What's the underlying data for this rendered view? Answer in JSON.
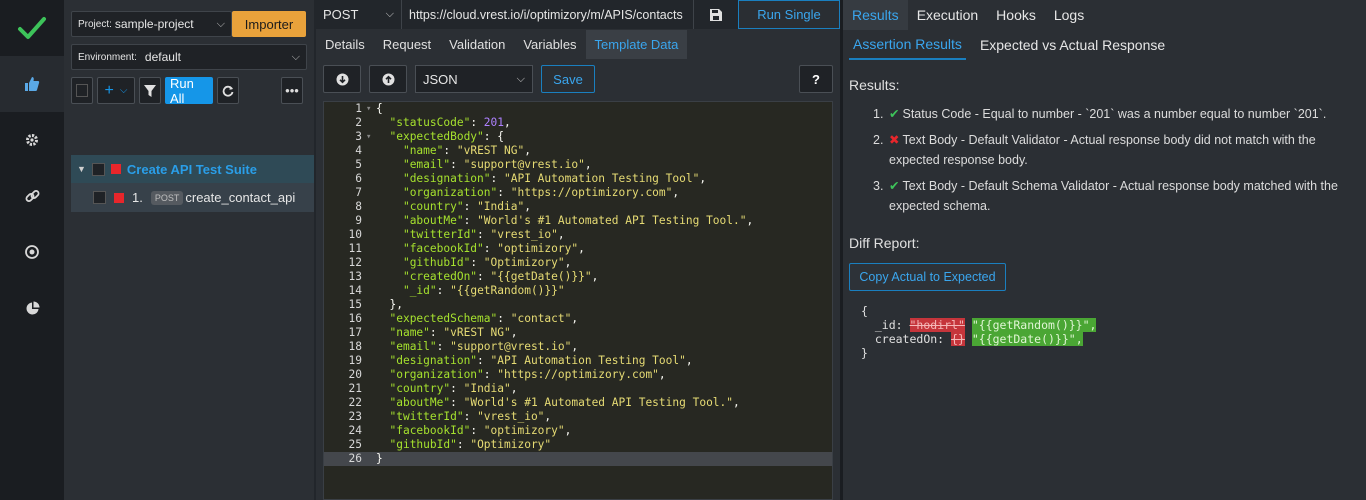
{
  "rail": {
    "items": [
      "checkmark-logo",
      "thumbs-up-icon",
      "gear-icon",
      "link-icon",
      "target-icon",
      "pie-chart-icon"
    ],
    "accent": "#3dc35a"
  },
  "sidebar": {
    "project_label": "Project:",
    "project_value": "sample-project",
    "importer_label": "Importer",
    "environment_label": "Environment:",
    "environment_value": "default",
    "run_all_label": "Run All",
    "suite_title": "Create API Test Suite",
    "testcase_index": "1.",
    "testcase_method": "POST",
    "testcase_name": "create_contact_api"
  },
  "request": {
    "method": "POST",
    "url": "https://cloud.vrest.io/i/optimizory/m/APIS/contacts",
    "run_single_label": "Run Single",
    "tabs": [
      "Details",
      "Request",
      "Validation",
      "Variables",
      "Template Data"
    ],
    "active_tab": "Template Data",
    "format": "JSON",
    "save_label": "Save",
    "help_label": "?"
  },
  "editor": {
    "lines": [
      "{",
      "  \"statusCode\": 201,",
      "  \"expectedBody\": {",
      "    \"name\": \"vREST NG\",",
      "    \"email\": \"support@vrest.io\",",
      "    \"designation\": \"API Automation Testing Tool\",",
      "    \"organization\": \"https://optimizory.com\",",
      "    \"country\": \"India\",",
      "    \"aboutMe\": \"World's #1 Automated API Testing Tool.\",",
      "    \"twitterId\": \"vrest_io\",",
      "    \"facebookId\": \"optimizory\",",
      "    \"githubId\": \"Optimizory\",",
      "    \"createdOn\": \"{{getDate()}}\",",
      "    \"_id\": \"{{getRandom()}}\"",
      "  },",
      "  \"expectedSchema\": \"contact\",",
      "  \"name\": \"vREST NG\",",
      "  \"email\": \"support@vrest.io\",",
      "  \"designation\": \"API Automation Testing Tool\",",
      "  \"organization\": \"https://optimizory.com\",",
      "  \"country\": \"India\",",
      "  \"aboutMe\": \"World's #1 Automated API Testing Tool.\",",
      "  \"twitterId\": \"vrest_io\",",
      "  \"facebookId\": \"optimizory\",",
      "  \"githubId\": \"Optimizory\"",
      "}"
    ],
    "fold_lines": [
      1,
      3
    ],
    "current_line": 26
  },
  "response": {
    "tabs": [
      "Results",
      "Execution",
      "Hooks",
      "Logs"
    ],
    "active_tab": "Results",
    "subtabs": [
      "Assertion Results",
      "Expected vs Actual Response"
    ],
    "active_subtab": "Assertion Results",
    "results_heading": "Results:",
    "results": [
      {
        "num": "1.",
        "status": "pass",
        "text": "Status Code - Equal to number - `201` was a number equal to number `201`."
      },
      {
        "num": "2.",
        "status": "fail",
        "text": "Text Body - Default Validator - Actual response body did not match with the expected response body."
      },
      {
        "num": "3.",
        "status": "pass",
        "text": "Text Body - Default Schema Validator - Actual response body matched with the expected schema."
      }
    ],
    "diff_heading": "Diff Report:",
    "copy_label": "Copy Actual to Expected",
    "diff": {
      "open": "{",
      "id_key": "_id:",
      "id_old": "\"hodirl\"",
      "id_new": "\"{{getRandom()}}\",",
      "created_key": "createdOn:",
      "created_old": "{}",
      "created_new": "\"{{getDate()}}\",",
      "close": "}"
    }
  },
  "colors": {
    "accent_blue": "#3aa6ee",
    "importer_orange": "#e9a23b",
    "pass_green": "#3dc35a",
    "fail_red": "#e8262b"
  }
}
